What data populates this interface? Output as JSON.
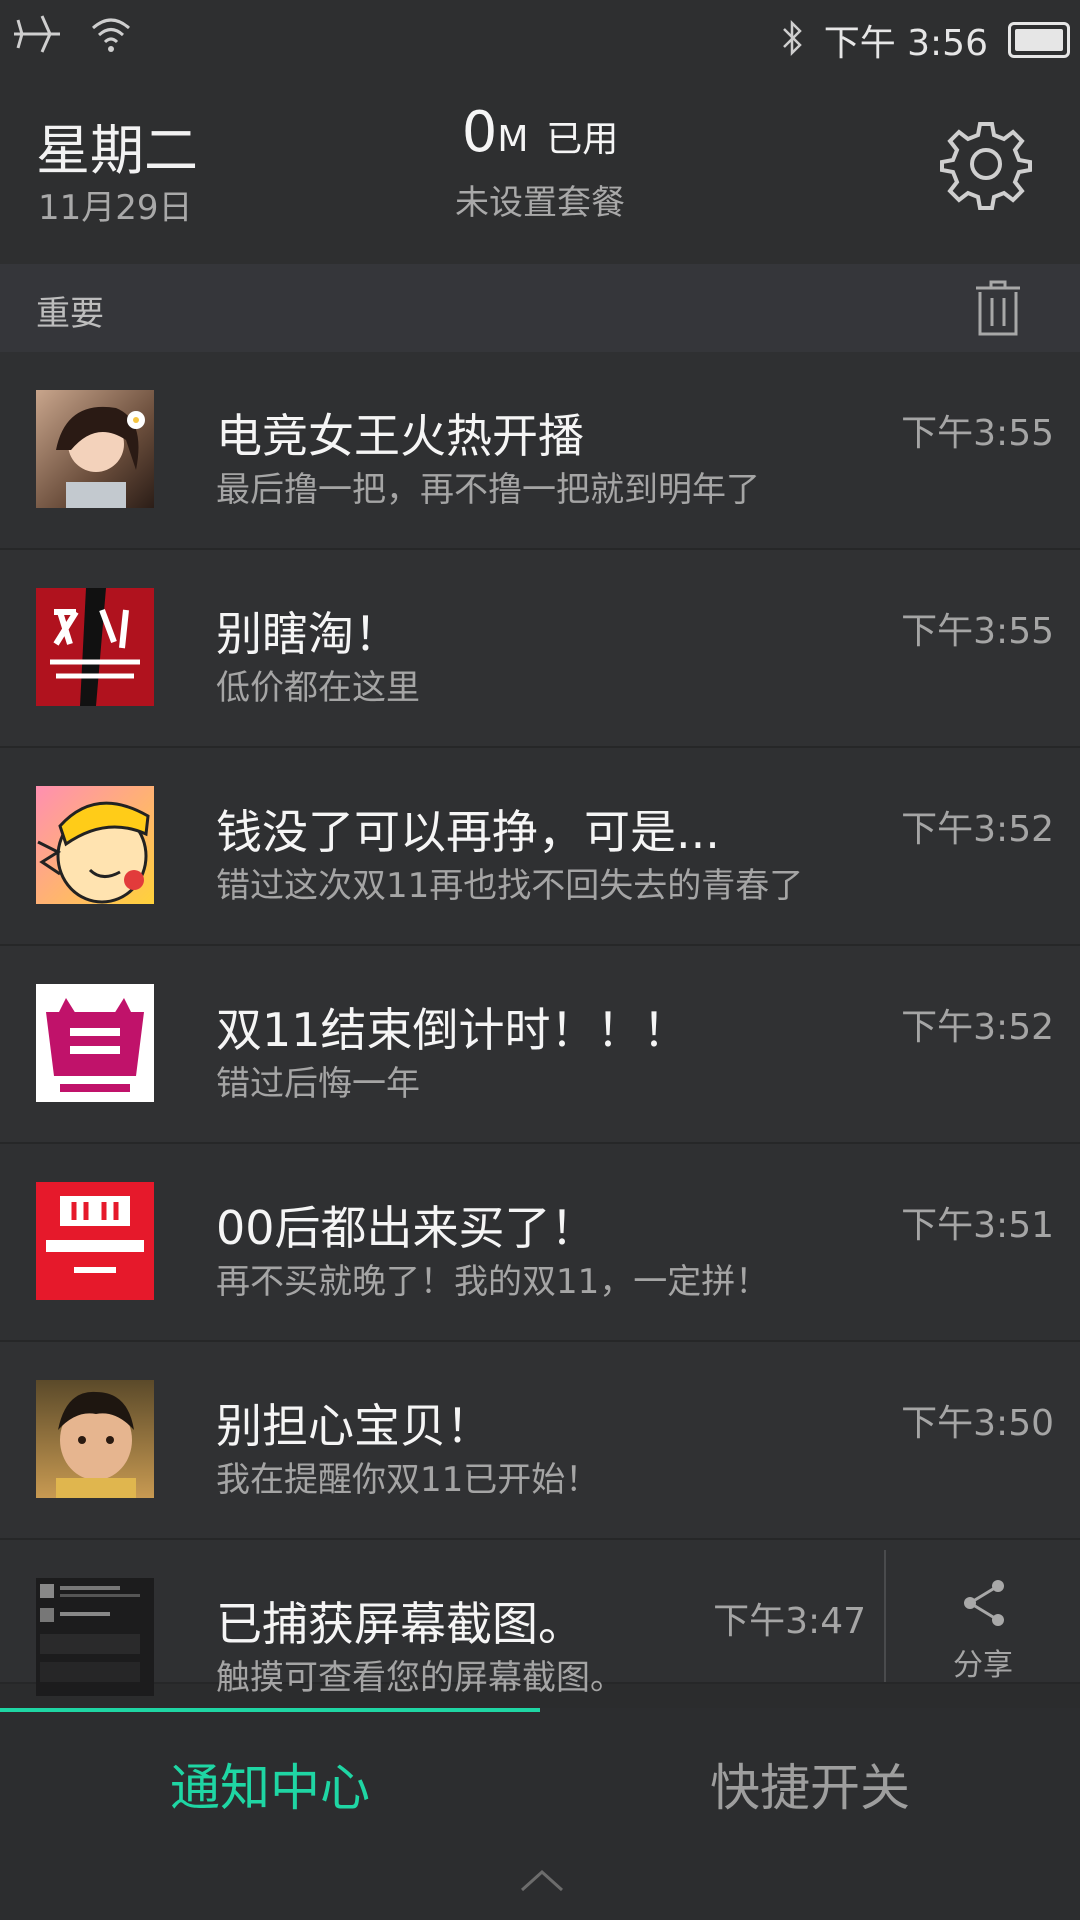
{
  "status_bar": {
    "time": "下午 3:56"
  },
  "header": {
    "day": "星期二",
    "date": "11月29日",
    "data_value": "0",
    "data_unit": "M",
    "data_used_label": "已用",
    "plan_label": "未设置套餐"
  },
  "section": {
    "title": "重要"
  },
  "notifications": [
    {
      "title": "电竞女王火热开播",
      "body": "最后撸一把，再不撸一把就到明年了",
      "time": "下午3:55",
      "icon": "avatar-girl"
    },
    {
      "title": "别瞎淘！",
      "body": "低价都在这里",
      "time": "下午3:55",
      "icon": "double11-carnival-logo"
    },
    {
      "title": "钱没了可以再挣，可是...",
      "body": "错过这次双11再也找不回失去的青春了",
      "time": "下午3:52",
      "icon": "cartoon-face"
    },
    {
      "title": "双11结束倒计时！！！",
      "body": "错过后悔一年",
      "time": "下午3:52",
      "icon": "countdown-logo"
    },
    {
      "title": "00后都出来买了！",
      "body": "再不买就晚了！我的双11，一定拼！",
      "time": "下午3:51",
      "icon": "global-festival-2016"
    },
    {
      "title": "别担心宝贝！",
      "body": "我在提醒你双11已开始！",
      "time": "下午3:50",
      "icon": "child-photo"
    },
    {
      "title": "已捕获屏幕截图。",
      "body": "触摸可查看您的屏幕截图。",
      "time": "下午3:47",
      "icon": "screenshot-thumbnail",
      "action": "分享"
    }
  ],
  "tabs": {
    "notification_center": "通知中心",
    "quick_toggles": "快捷开关"
  },
  "colors": {
    "accent": "#1fd6a4",
    "background": "#2b2c2d"
  }
}
